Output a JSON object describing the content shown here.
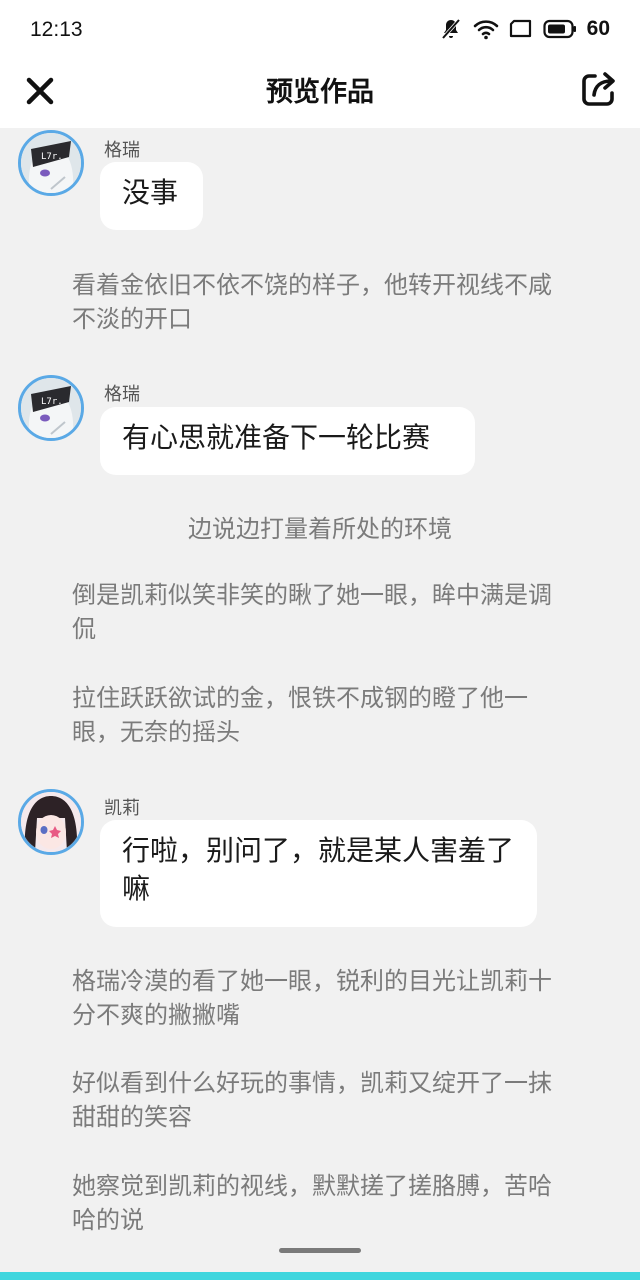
{
  "status": {
    "time": "12:13",
    "battery": "60",
    "icons": [
      "mute-icon",
      "wifi-icon",
      "screen-icon",
      "battery-icon"
    ]
  },
  "header": {
    "title": "预览作品",
    "close_icon": "close-icon",
    "share_icon": "share-icon"
  },
  "messages": [
    {
      "speaker": "格瑞",
      "text": "没事"
    },
    {
      "narration": "看着金依旧不依不饶的样子，他转开视线不咸不淡的开口"
    },
    {
      "speaker": "格瑞",
      "text": "有心思就准备下一轮比赛"
    },
    {
      "narration": "边说边打量着所处的环境"
    },
    {
      "narration": "倒是凯莉似笑非笑的瞅了她一眼，眸中满是调侃"
    },
    {
      "narration": "拉住跃跃欲试的金，恨铁不成钢的瞪了他一眼，无奈的摇头"
    },
    {
      "speaker": "凯莉",
      "text": "行啦，别问了，就是某人害羞了嘛"
    },
    {
      "narration": "格瑞冷漠的看了她一眼，锐利的目光让凯莉十分不爽的撇撇嘴"
    },
    {
      "narration": "好似看到什么好玩的事情，凯莉又绽开了一抹甜甜的笑容"
    },
    {
      "narration": "她察觉到凯莉的视线，默默搓了搓胳膊，苦哈哈的说"
    }
  ],
  "colors": {
    "background": "#f1f1f1",
    "bubble": "#ffffff",
    "avatar_border": "#5aa9e6",
    "narration_text": "#7b7b7b",
    "bottom_accent": "#3fd6de"
  }
}
